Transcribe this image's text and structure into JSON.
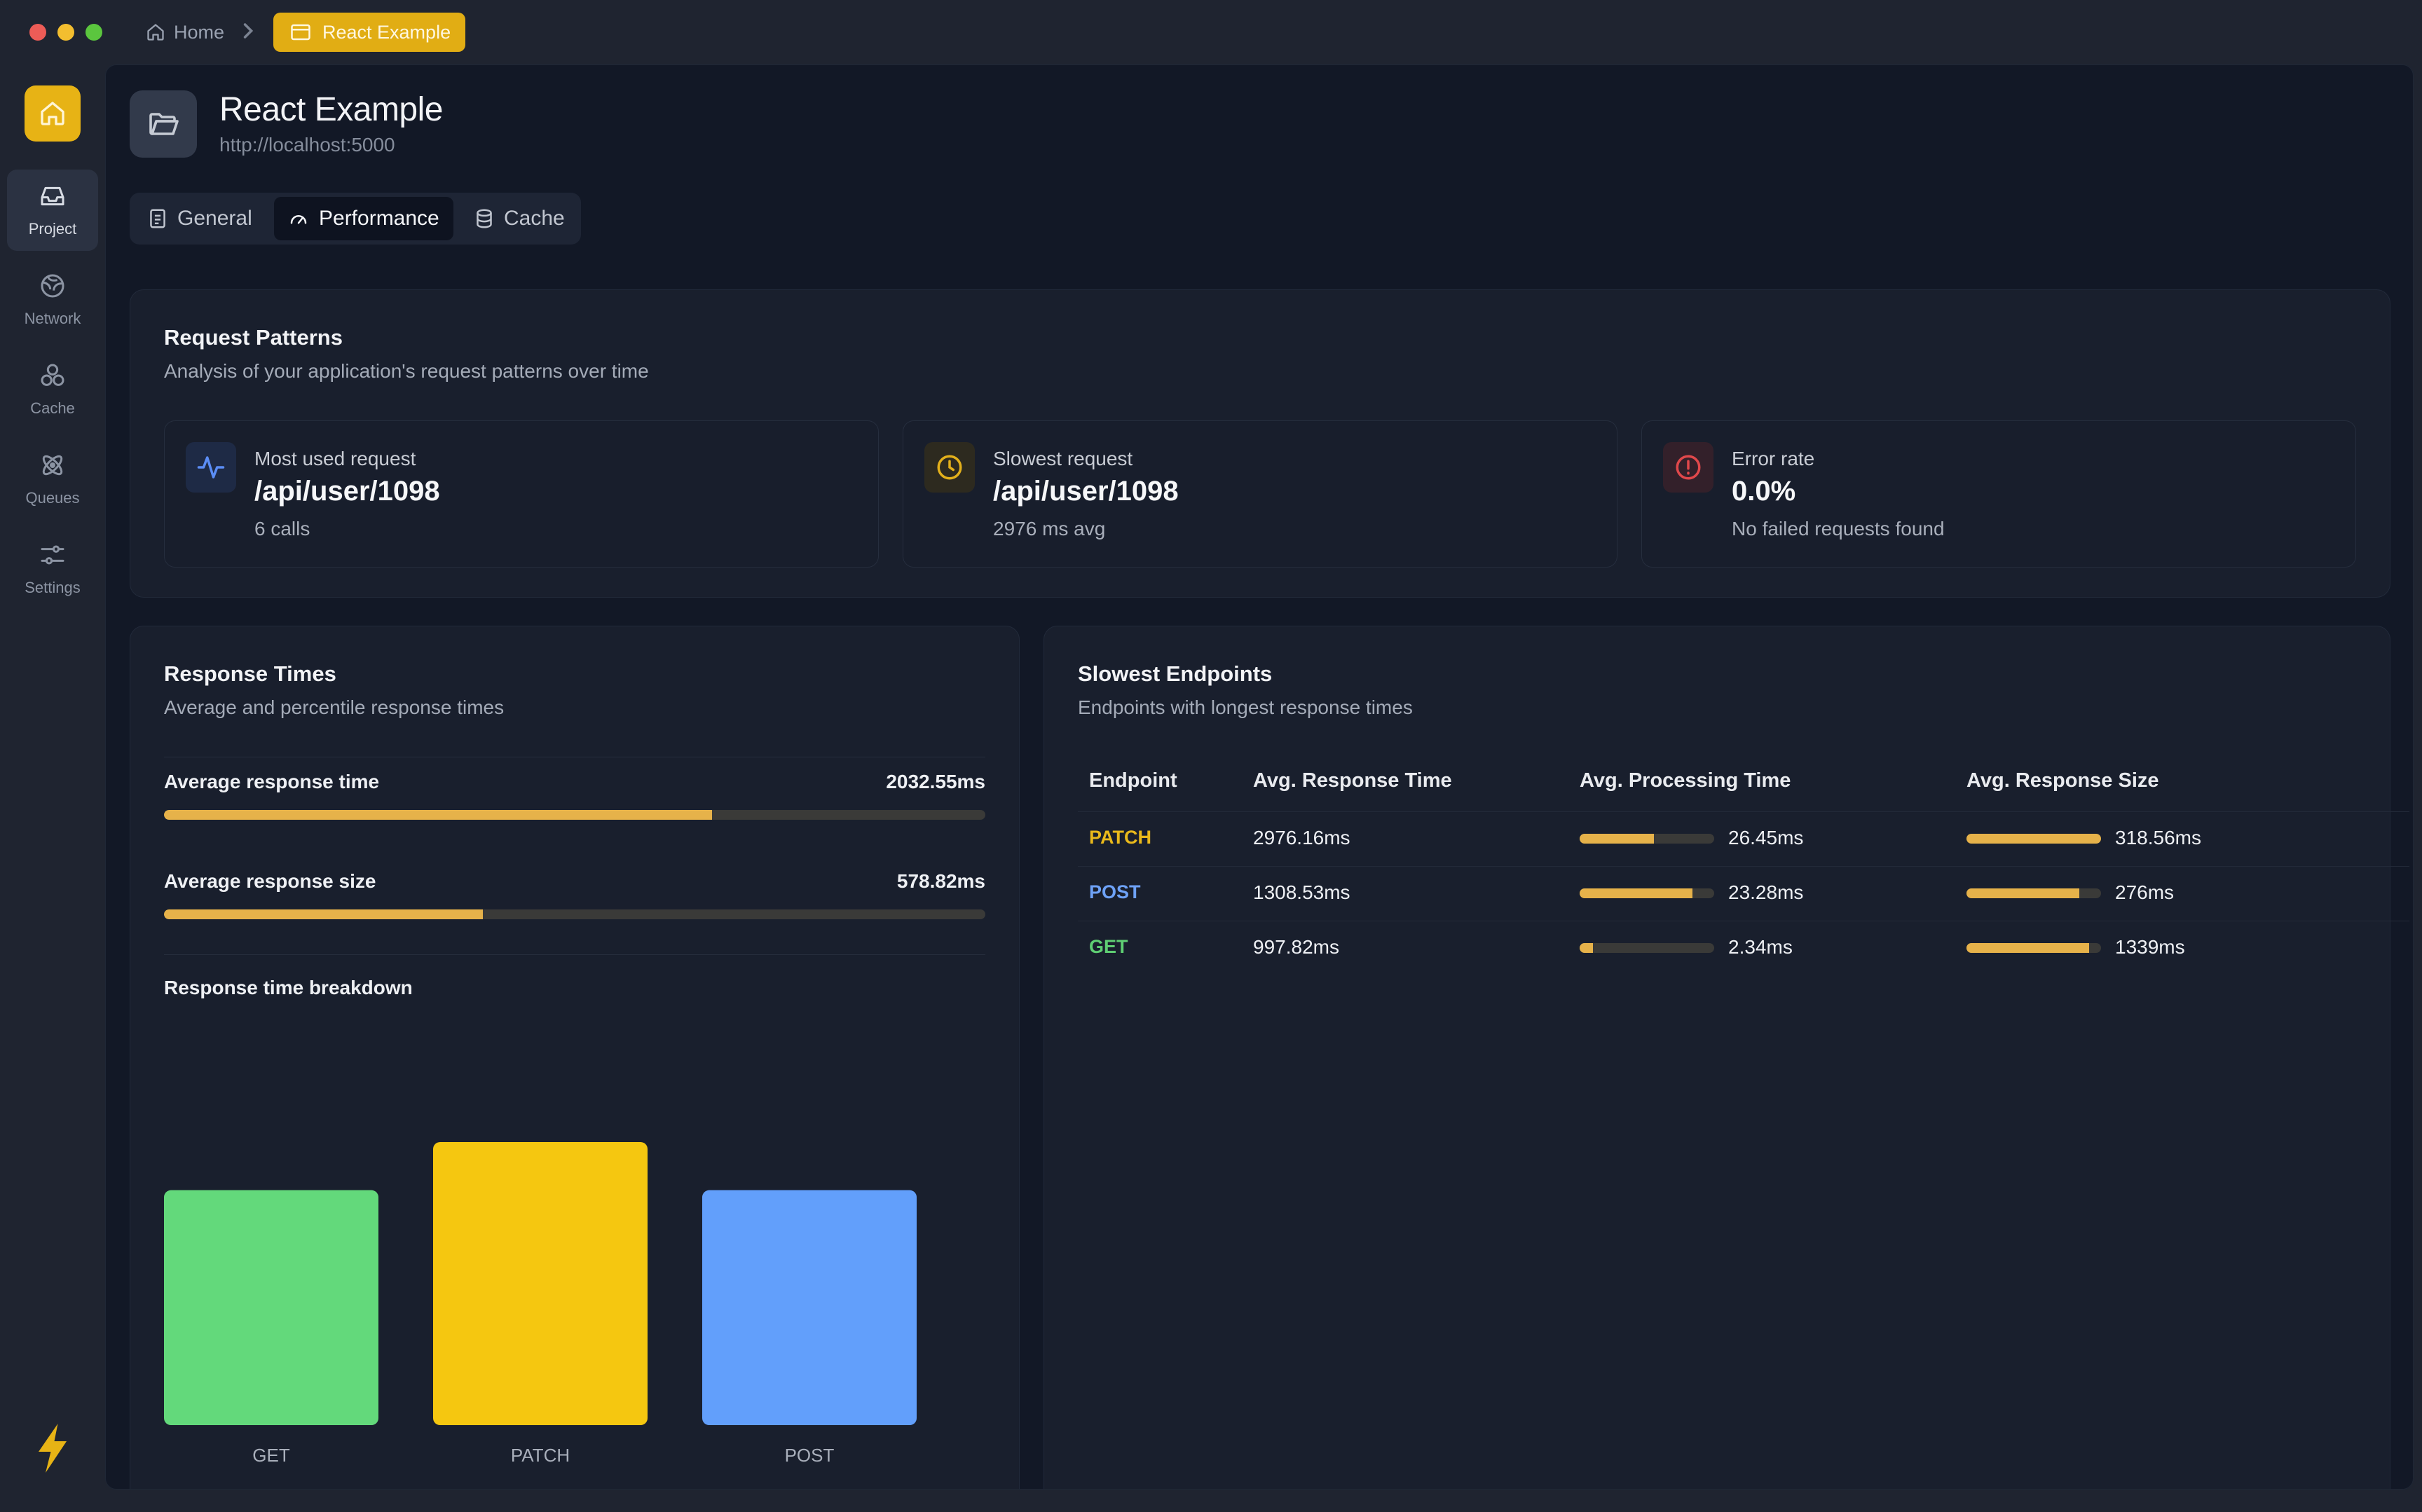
{
  "titlebar": {
    "breadcrumb_home": "Home",
    "breadcrumb_current": "React Example"
  },
  "sidebar": {
    "items": [
      {
        "label": "Project",
        "icon": "inbox-icon",
        "active": true
      },
      {
        "label": "Network",
        "icon": "globe-icon",
        "active": false
      },
      {
        "label": "Cache",
        "icon": "boxes-icon",
        "active": false
      },
      {
        "label": "Queues",
        "icon": "atom-icon",
        "active": false
      },
      {
        "label": "Settings",
        "icon": "sliders-icon",
        "active": false
      }
    ]
  },
  "project": {
    "title": "React Example",
    "url": "http://localhost:5000"
  },
  "tabs": [
    {
      "label": "General",
      "active": false
    },
    {
      "label": "Performance",
      "active": true
    },
    {
      "label": "Cache",
      "active": false
    }
  ],
  "request_patterns": {
    "title": "Request Patterns",
    "subtitle": "Analysis of your application's request patterns over time",
    "stats": [
      {
        "label": "Most used request",
        "value": "/api/user/1098",
        "note": "6 calls",
        "icon": "activity-icon",
        "color": "#5b8df5"
      },
      {
        "label": "Slowest request",
        "value": "/api/user/1098",
        "note": "2976 ms avg",
        "icon": "clock-icon",
        "color": "#e3b01b"
      },
      {
        "label": "Error rate",
        "value": "0.0%",
        "note": "No failed requests found",
        "icon": "alert-circle-icon",
        "color": "#e0484b"
      }
    ]
  },
  "response_times": {
    "title": "Response Times",
    "subtitle": "Average and percentile response times",
    "metrics": [
      {
        "label": "Average response time",
        "value": "2032.55ms",
        "fraction": 0.667
      },
      {
        "label": "Average response size",
        "value": "578.82ms",
        "fraction": 0.388
      }
    ],
    "breakdown_title": "Response time breakdown"
  },
  "chart_data": {
    "type": "bar",
    "categories": [
      "GET",
      "PATCH",
      "POST"
    ],
    "values": [
      0.83,
      1.0,
      0.83
    ],
    "colors": [
      "#63d97b",
      "#f5c710",
      "#629ffb"
    ],
    "title": "Response time breakdown",
    "xlabel": "",
    "ylabel": ""
  },
  "slowest_endpoints": {
    "title": "Slowest Endpoints",
    "subtitle": "Endpoints with longest response times",
    "headers": [
      "Endpoint",
      "Avg. Response Time",
      "Avg. Processing Time",
      "Avg. Response Size"
    ],
    "rows": [
      {
        "method": "PATCH",
        "method_color": "#e9b91b",
        "response_time": "2976.16ms",
        "processing_time": "26.45ms",
        "processing_fraction": 0.55,
        "response_size": "318.56ms",
        "size_fraction": 1.0
      },
      {
        "method": "POST",
        "method_color": "#6ea2f7",
        "response_time": "1308.53ms",
        "processing_time": "23.28ms",
        "processing_fraction": 0.84,
        "response_size": "276ms",
        "size_fraction": 0.84
      },
      {
        "method": "GET",
        "method_color": "#5fcf73",
        "response_time": "997.82ms",
        "processing_time": "2.34ms",
        "processing_fraction": 0.1,
        "response_size": "1339ms",
        "size_fraction": 0.91
      }
    ]
  },
  "colors": {
    "accent": "#e7b315",
    "background": "#121826",
    "card": "#191f2d"
  }
}
